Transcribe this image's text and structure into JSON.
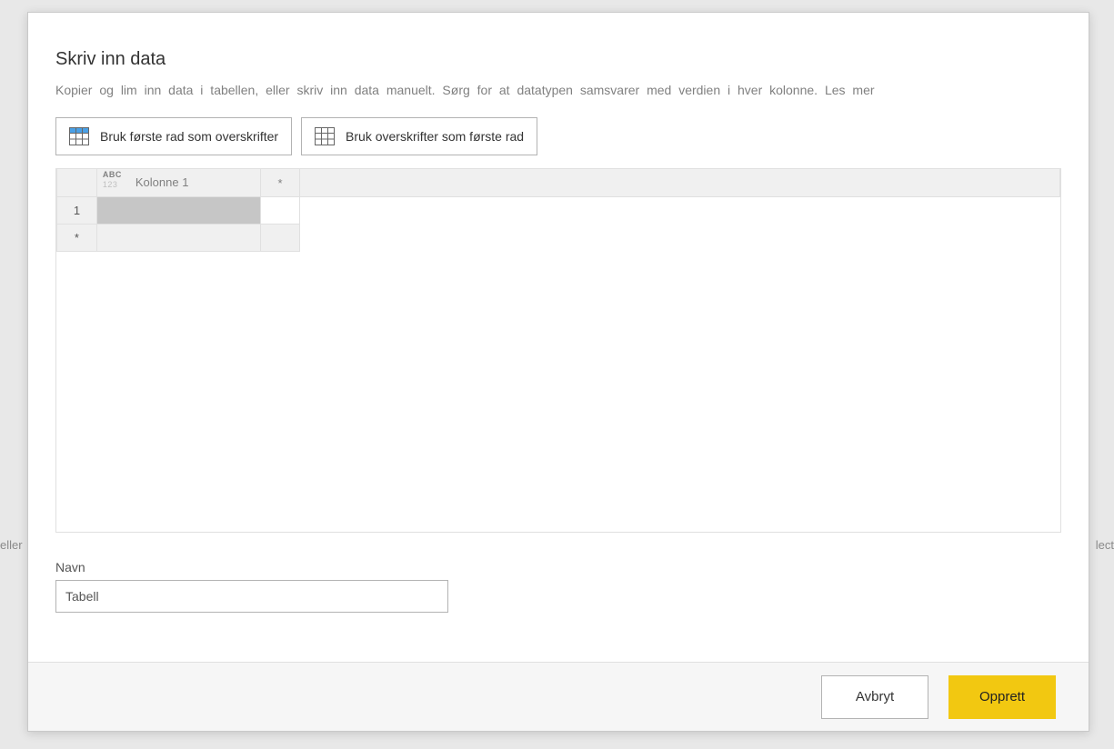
{
  "backdrop": {
    "left_fragment": "eller",
    "right_fragment": "lect"
  },
  "dialog": {
    "title": "Skriv inn data",
    "description": "Kopier og lim inn data i tabellen, eller skriv inn data manuelt. Sørg for at datatypen samsvarer med verdien i hver kolonne. ",
    "learn_more": "Les mer"
  },
  "toolbar": {
    "first_row_headers": "Bruk første rad som overskrifter",
    "headers_first_row": "Bruk overskrifter som første rad"
  },
  "grid": {
    "type_icon_top": "ABC",
    "type_icon_bottom": "123",
    "column1_name": "Kolonne 1",
    "add_col_marker": "*",
    "row1_number": "1",
    "add_row_marker": "*",
    "cell_value": ""
  },
  "name": {
    "label": "Navn",
    "value": "Tabell"
  },
  "footer": {
    "cancel": "Avbryt",
    "create": "Opprett"
  }
}
